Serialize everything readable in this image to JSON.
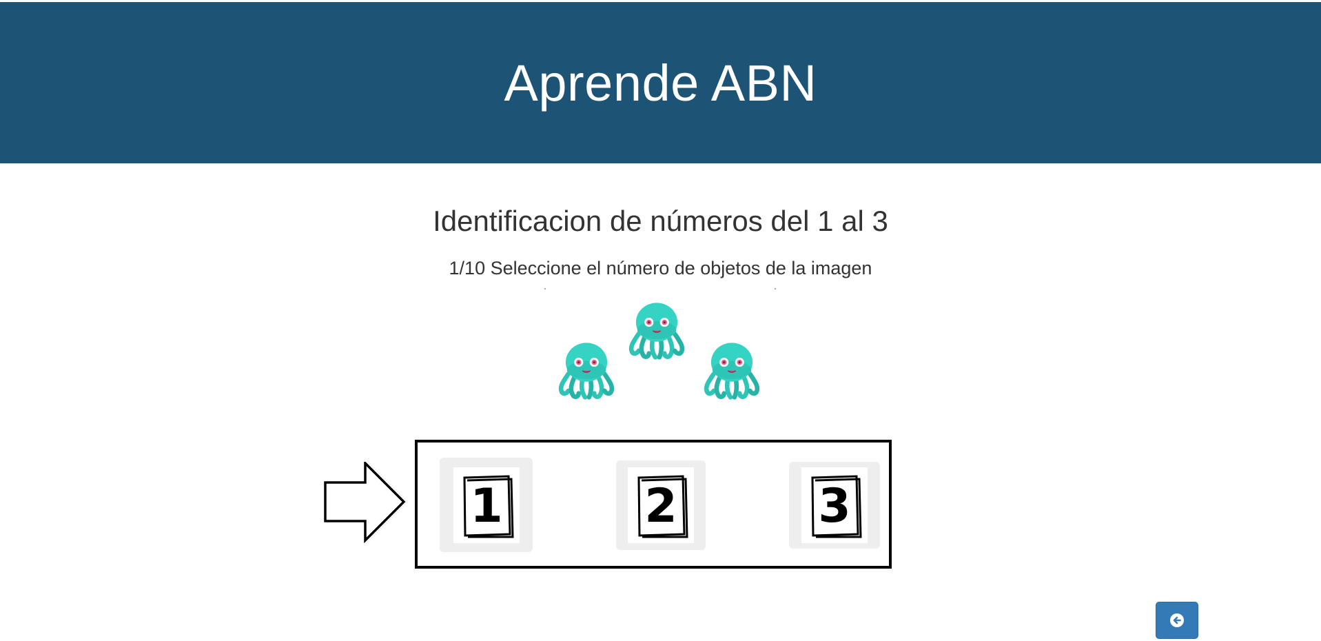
{
  "header": {
    "title": "Aprende ABN"
  },
  "exercise": {
    "title": "Identificacion de números del 1 al 3",
    "instruction": "1/10 Seleccione el número de objetos de la imagen",
    "objects": {
      "icon": "octopus-icon",
      "count": 3,
      "color": "#2ec4b6"
    }
  },
  "options": [
    {
      "number": "1"
    },
    {
      "number": "2"
    },
    {
      "number": "3"
    }
  ],
  "colors": {
    "header_bg": "#1d5375",
    "button_bg": "#337ab7",
    "option_bg": "#eeeeee"
  },
  "footer": {
    "back_icon": "arrow-left-circle-icon"
  }
}
